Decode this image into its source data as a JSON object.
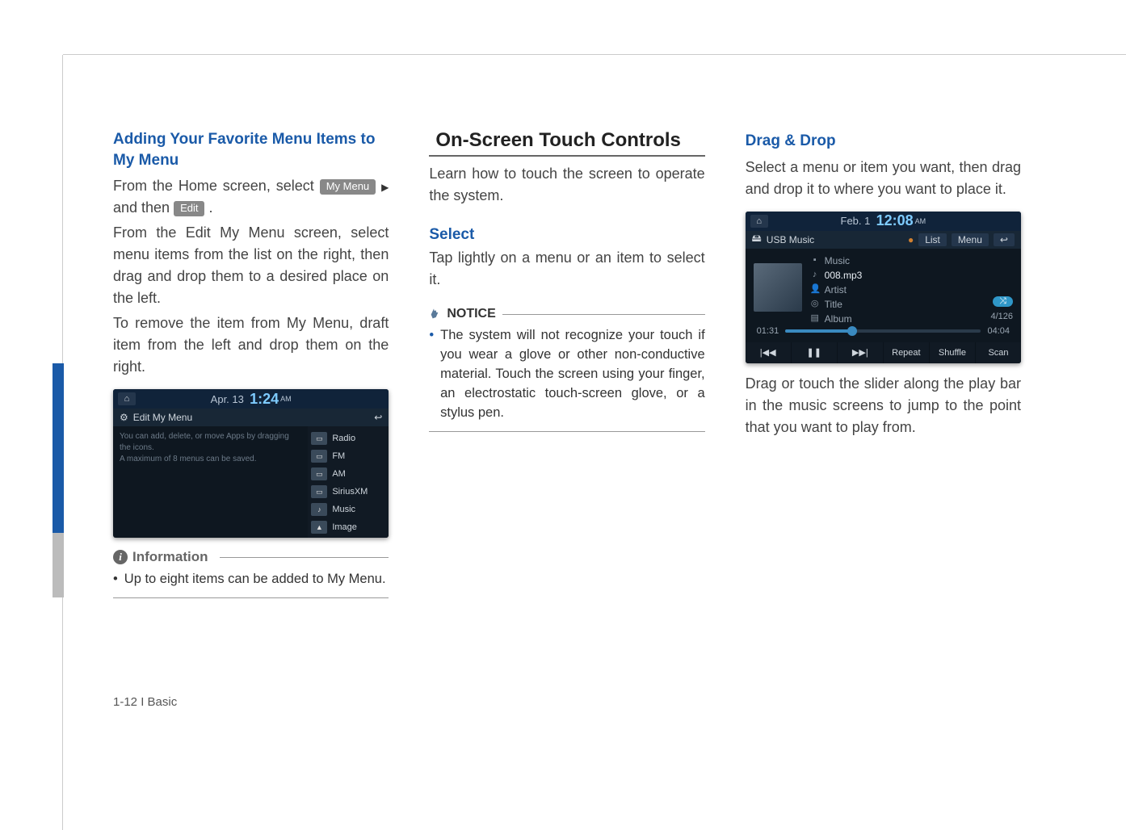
{
  "col1": {
    "heading": "Adding Your Favorite Menu Items to My Menu",
    "p1_a": "From the Home screen, select ",
    "btn_mymenu": "My Menu",
    "p1_b": " and then ",
    "btn_edit": "Edit",
    "p1_c": " .",
    "p2": "From the Edit My Menu screen, select menu items from the list on the right, then drag and drop them to a desired place on the left.",
    "p3": "To remove the item from My Menu, draft item from the left and drop them on the right.",
    "info_label": "Information",
    "info_bullet": "Up to eight items can be added to My Menu."
  },
  "editshot": {
    "date": "Apr. 13",
    "time": "1:24",
    "ampm": "AM",
    "title": "Edit My Menu",
    "hint1": "You can add, delete, or move Apps by dragging the icons.",
    "hint2": "A maximum of 8 menus can be saved.",
    "apps": [
      "Radio",
      "FM",
      "AM",
      "SiriusXM",
      "Music",
      "Image"
    ]
  },
  "col2": {
    "section": "On-Screen Touch Controls",
    "intro": "Learn how to touch the screen to operate the system.",
    "select_h": "Select",
    "select_p": "Tap lightly on a menu or an item to select it.",
    "notice_label": "NOTICE",
    "notice_bullet": "The system will not recognize your touch if you wear a glove or other non-conductive material. Touch the screen using your finger, an electrostatic touch-screen glove, or a stylus pen."
  },
  "col3": {
    "heading": "Drag & Drop",
    "p1": "Select a menu or item you want, then drag and drop it to where you want to place it.",
    "p2": "Drag or touch the slider along the play bar in the music screens to jump to the point that you want to play from."
  },
  "musicshot": {
    "date": "Feb.  1",
    "time": "12:08",
    "ampm": "AM",
    "title": "USB Music",
    "list_btn": "List",
    "menu_btn": "Menu",
    "meta_music": "Music",
    "track": "008.mp3",
    "artist": "Artist",
    "title_lbl": "Title",
    "album": "Album",
    "counter": "4/126",
    "t_cur": "01:31",
    "t_tot": "04:04",
    "ctrl_repeat": "Repeat",
    "ctrl_shuffle": "Shuffle",
    "ctrl_scan": "Scan"
  },
  "footer": "1-12 I Basic"
}
